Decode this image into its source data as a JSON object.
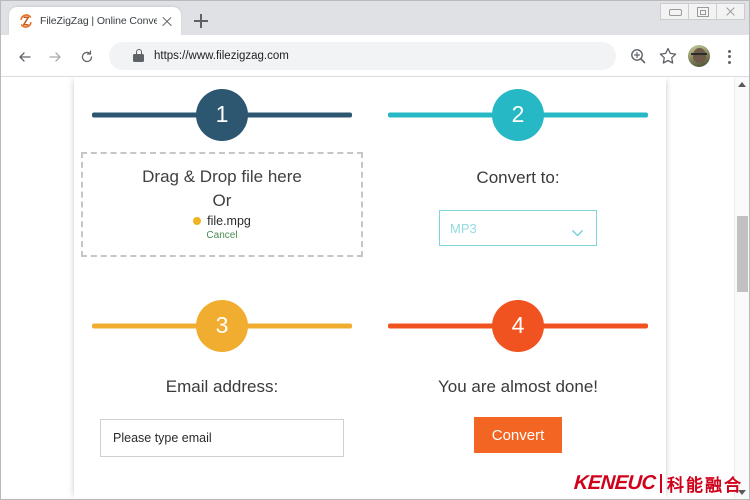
{
  "browser": {
    "tab": {
      "title": "FileZigZag | Online Converter:",
      "favicon_name": "filezigzag-favicon",
      "close_label": "Close tab"
    },
    "new_tab_label": "New Tab",
    "window_controls": {
      "minimize": "Minimize",
      "maximize": "Maximize",
      "close": "Close"
    },
    "toolbar": {
      "back_label": "Back",
      "forward_label": "Forward",
      "reload_label": "Reload",
      "url": "https://www.filezigzag.com",
      "zoom_label": "Zoom",
      "bookmark_label": "Bookmark this page",
      "profile_label": "Profile",
      "menu_label": "Customize and control Google Chrome"
    }
  },
  "page": {
    "steps": [
      {
        "number": "1",
        "color": "#2d5670",
        "label": "",
        "dropzone": {
          "title": "Drag & Drop file here",
          "or": "Or",
          "file_name": "file.mpg",
          "cancel": "Cancel"
        }
      },
      {
        "number": "2",
        "color": "#26b8c4",
        "label": "Convert to:",
        "select": {
          "value": "MP3",
          "options": [
            "MP3"
          ]
        }
      },
      {
        "number": "3",
        "color": "#f0ad30",
        "label": "Email address:",
        "input": {
          "value": "Please type email",
          "placeholder": "Please type email"
        }
      },
      {
        "number": "4",
        "color": "#f0531f",
        "label": "You are almost done!",
        "button": {
          "text": "Convert",
          "color": "#f26522"
        }
      }
    ],
    "watermark": {
      "latin": "KENEUC",
      "chinese": "科能融合",
      "color": "#d0021b"
    }
  }
}
